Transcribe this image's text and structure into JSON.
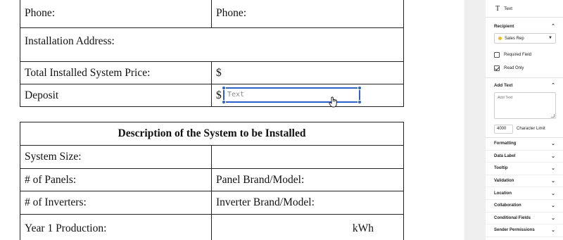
{
  "document": {
    "table1": {
      "phone_left": "Phone:",
      "phone_right": "Phone:",
      "installation_address": "Installation Address:",
      "total_price_label": "Total Installed System Price:",
      "total_price_currency": "$",
      "deposit_label": "Deposit",
      "deposit_currency": "$"
    },
    "text_field": {
      "placeholder": "Text"
    },
    "table2": {
      "title": "Description of the System to be Installed",
      "system_size": "System Size:",
      "num_panels": "# of Panels:",
      "panel_brand": "Panel Brand/Model:",
      "num_inverters": "# of Inverters:",
      "inverter_brand": "Inverter Brand/Model:",
      "year1_production": "Year 1 Production:",
      "kwh_unit": "kWh"
    }
  },
  "panel": {
    "field_type": "Text",
    "recipient": {
      "heading": "Recipient",
      "value": "Sales Rep",
      "color": "#f3b72c"
    },
    "required_field": {
      "label": "Required Field",
      "checked": false
    },
    "read_only": {
      "label": "Read Only",
      "checked": true
    },
    "add_text": {
      "heading": "Add Text",
      "placeholder": "Add Text",
      "limit_value": "4000",
      "limit_label": "Character Limit"
    },
    "sections": [
      "Formatting",
      "Data Label",
      "Tooltip",
      "Validation",
      "Location",
      "Collaboration",
      "Conditional Fields",
      "Sender Permissions"
    ]
  },
  "colors": {
    "accent": "#2a62c9",
    "gutter": "#efefef"
  }
}
